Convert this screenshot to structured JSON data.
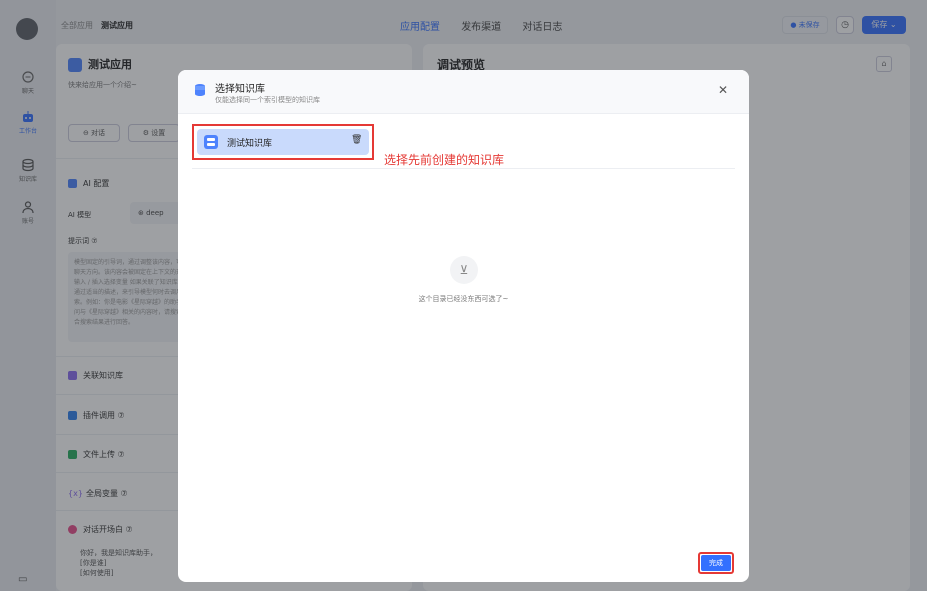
{
  "nav": {
    "items": [
      {
        "label": "聊天",
        "icon": "chat-icon"
      },
      {
        "label": "工作台",
        "icon": "robot-icon"
      },
      {
        "label": "知识库",
        "icon": "database-icon"
      },
      {
        "label": "账号",
        "icon": "user-icon"
      }
    ]
  },
  "topbar": {
    "crumb_all": "全部应用",
    "crumb_current": "测试应用",
    "tabs": [
      "应用配置",
      "发布渠道",
      "对话日志"
    ],
    "unsaved": "● 未保存",
    "save": "保存 ⌄",
    "clock": "◷"
  },
  "left": {
    "app_name": "测试应用",
    "app_intro": "快来给应用一个介绍~",
    "chat_btn": "⊖ 对话",
    "settings_btn": "⚙ 设置",
    "ai_config": "AI 配置",
    "ai_model_label": "AI 模型",
    "ai_model_value": "⊛ deep",
    "prompt_label": "提示词 ⑦",
    "prompt_text": "模型固定的引导词，通过调整该内容，可以引导模型聊天方向。该内容会被固定在上下文的开头。可通过输入 / 插入选择变量 如果关联了知识库，你还可以通过适当的描述，来引导模型何时去调用知识库搜索。例如：你是电影《星际穿越》的助手，当用户询问与《星际穿越》相关的内容时，请搜索知识库并结合搜索结果进行回答。",
    "sections": [
      "关联知识库",
      "插件调用 ⑦",
      "文件上传 ⑦",
      "全局变量 ⑦",
      "对话开场白 ⑦"
    ],
    "greeting_lines": [
      "你好，我是知识库助手，",
      "[你是谁]",
      "[如何使用]"
    ]
  },
  "right": {
    "preview_title": "调试预览",
    "home": "⌂"
  },
  "modal": {
    "title": "选择知识库",
    "subtitle": "仅能选择同一个索引模型的知识库",
    "close": "✕",
    "selected_kb": "测试知识库",
    "delete": "🗑",
    "annotation": "选择先前创建的知识库",
    "empty_icon": "⊻",
    "empty_text": "这个目录已经没东西可选了~",
    "done": "完成"
  },
  "colors": {
    "primary": "#3370ff",
    "highlight": "#e53935"
  }
}
